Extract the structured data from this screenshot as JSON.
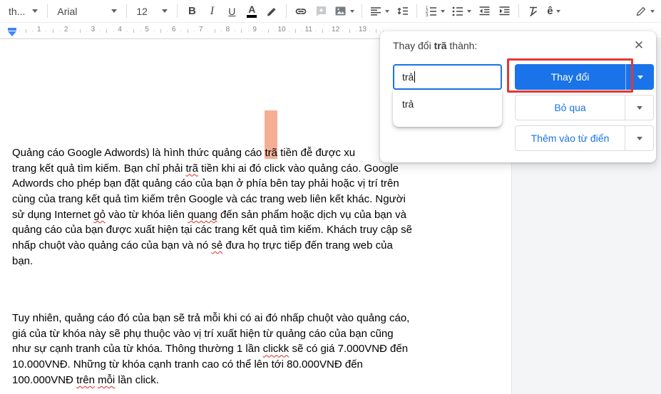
{
  "colors": {
    "accent": "#1a73e8",
    "red_box": "#e4382f",
    "match_highlight": "#f5ae94",
    "error_underline": "#e02b20"
  },
  "toolbar": {
    "style_value": "th...",
    "font_value": "Arial",
    "size_value": "12",
    "bold_glyph": "B",
    "italic_glyph": "I",
    "underline_glyph": "U",
    "text_color_glyph": "A",
    "input_tools_glyph": "ê"
  },
  "ruler": {
    "numbers": [
      1,
      2,
      3,
      4,
      5,
      6,
      7,
      8,
      9,
      10,
      11,
      12,
      13
    ]
  },
  "dialog": {
    "title_prefix": "Thay đổi ",
    "title_word": "trã",
    "title_suffix": " thành:",
    "close_glyph": "✕",
    "input_value": "trả",
    "suggestion": "trả",
    "change_label": "Thay đổi",
    "skip_label": "Bỏ qua",
    "add_label": "Thêm vào từ điển"
  },
  "document": {
    "paragraphs": [
      {
        "lines": [
          [
            {
              "text": "Quảng cáo Google Adwords) là hình thức quảng cáo "
            },
            {
              "text": "trã",
              "mark": "match"
            },
            {
              "text": " tiền đễ được xu"
            }
          ],
          [
            {
              "text": "trang kết quả tìm kiếm. Bạn chỉ phải "
            },
            {
              "text": "trã",
              "mark": "error"
            },
            {
              "text": " tiền khi ai đó click vào quảng cáo. Google"
            }
          ],
          [
            {
              "text": "Adwords cho phép bạn đặt quảng cáo của bạn ở phía bên tay phải hoặc vị trí trên"
            }
          ],
          [
            {
              "text": "cùng của trang kết quả tìm kiếm trên Google và các trang web liên kết khác. Người"
            }
          ],
          [
            {
              "text": "sử dụng Internet "
            },
            {
              "text": "gỏ",
              "mark": "error"
            },
            {
              "text": " vào từ khóa liên "
            },
            {
              "text": "quang",
              "mark": "error"
            },
            {
              "text": " đến sản phẩm hoặc dịch vụ của bạn và"
            }
          ],
          [
            {
              "text": "quảng cáo của bạn được xuất hiện tại các trang kết quả tìm kiếm. Khách truy cập sẽ"
            }
          ],
          [
            {
              "text": "nhấp chuột vào quảng cáo của bạn và nó "
            },
            {
              "text": "sẻ",
              "mark": "error"
            },
            {
              "text": " đưa họ trực tiếp đến trang web của"
            }
          ],
          [
            {
              "text": "bạn."
            }
          ]
        ]
      },
      {
        "lines": [
          [
            {
              "text": "Tuy nhiên, quảng cáo đó của bạn sẽ trả mỗi khi có ai đó nhấp chuột vào quảng cáo,"
            }
          ],
          [
            {
              "text": "giá của từ khóa này sẽ phụ thuộc vào vị trí xuất hiện từ quảng cáo của bạn cũng"
            }
          ],
          [
            {
              "text": "như sự cạnh tranh của từ khóa. Thông thường 1 lần "
            },
            {
              "text": "clickk",
              "mark": "error"
            },
            {
              "text": " sẽ có giá 7.000VNĐ đến"
            }
          ],
          [
            {
              "text": "10.000VNĐ. Những từ khóa cạnh tranh cao có thể lên tới 80.000VNĐ đến"
            }
          ],
          [
            {
              "text": "100.000VNĐ "
            },
            {
              "text": "trên",
              "mark": "error"
            },
            {
              "text": " "
            },
            {
              "text": "mỗi",
              "mark": "error"
            },
            {
              "text": " lần click."
            }
          ]
        ]
      }
    ]
  }
}
